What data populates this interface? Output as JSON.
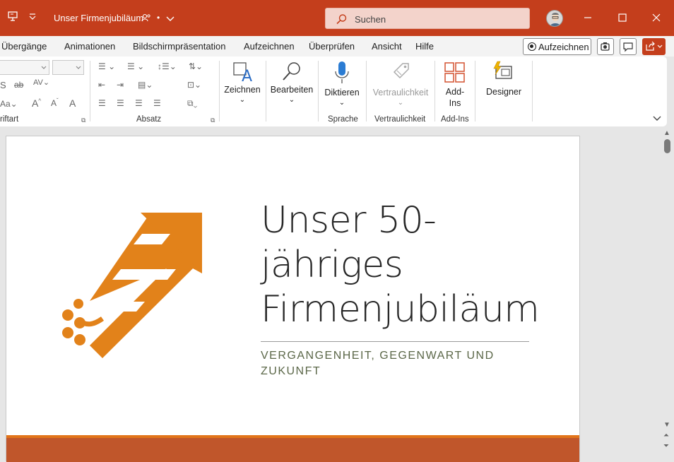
{
  "window": {
    "title": "Unser Firmenjubiläum",
    "title_suffix": "•",
    "search_placeholder": "Suchen"
  },
  "menu": {
    "items": [
      "Übergänge",
      "Animationen",
      "Bildschirmpräsentation",
      "Aufzeichnen",
      "Überprüfen",
      "Ansicht",
      "Hilfe"
    ],
    "record_button": "Aufzeichnen"
  },
  "ribbon": {
    "groups": {
      "font": "riftart",
      "paragraph": "Absatz",
      "voice": "Sprache",
      "sensitivity": "Vertraulichkeit",
      "addins": "Add-Ins"
    },
    "buttons": {
      "draw": "Zeichnen",
      "edit": "Bearbeiten",
      "dictate": "Diktieren",
      "sensitivity": "Vertraulichkeit",
      "addins_line1": "Add-",
      "addins_line2": "Ins",
      "designer": "Designer"
    }
  },
  "slide": {
    "title_line1": "Unser 50-",
    "title_line2": "jähriges",
    "title_line3": "Firmenjubiläum",
    "subtitle_line1": "VERGANGENHEIT, GEGENWART UND",
    "subtitle_line2": "ZUKUNFT"
  },
  "colors": {
    "titlebar": "#c43e1c",
    "accent_orange": "#e2751a",
    "band": "#c0562b",
    "subtitle": "#5b6748"
  }
}
